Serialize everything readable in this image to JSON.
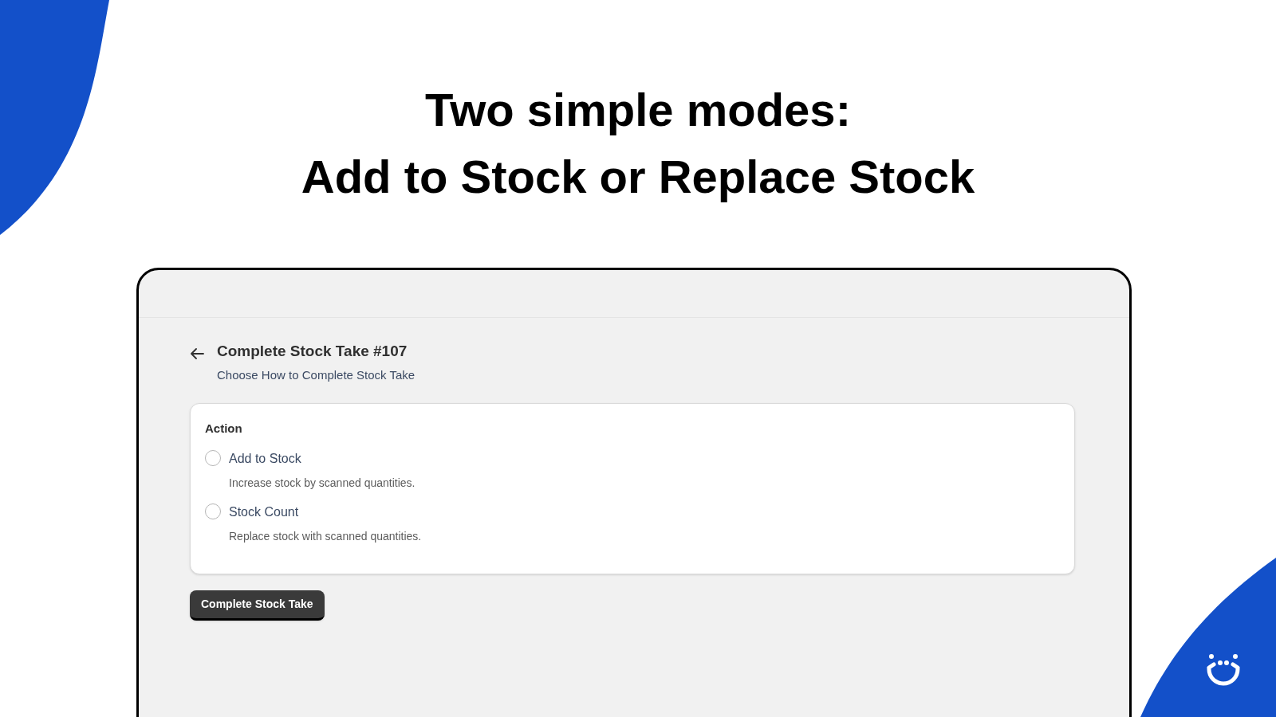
{
  "headline": [
    "Two simple modes:",
    "Add to Stock or Replace Stock"
  ],
  "page": {
    "title": "Complete Stock Take #107",
    "subtitle": "Choose How to Complete Stock Take"
  },
  "card": {
    "heading": "Action",
    "options": [
      {
        "label": "Add to Stock",
        "description": "Increase stock by scanned quantities.",
        "selected": false
      },
      {
        "label": "Stock Count",
        "description": "Replace stock with scanned quantities.",
        "selected": false
      }
    ]
  },
  "button": "Complete Stock Take"
}
